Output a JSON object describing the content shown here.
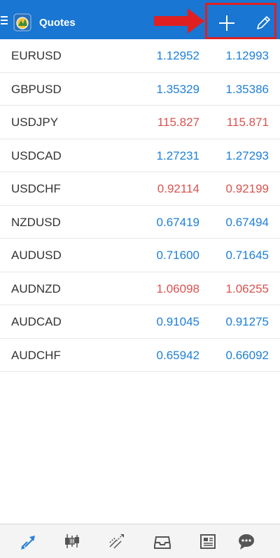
{
  "app": {
    "title": "Quotes"
  },
  "colors": {
    "accent": "#1976d2",
    "up": "#1e7fd8",
    "down": "#d9534f",
    "annotation": "#e02020",
    "nav_active": "#2a80d8",
    "nav_inactive": "#555555"
  },
  "icons": {
    "menu": "menu-icon",
    "logo": "metatrader-logo-icon",
    "add": "plus-icon",
    "edit": "pencil-icon",
    "annotation": "red-arrow-annotation"
  },
  "quotes": [
    {
      "symbol": "EURUSD",
      "bid": "1.12952",
      "ask": "1.12993",
      "direction": "up"
    },
    {
      "symbol": "GBPUSD",
      "bid": "1.35329",
      "ask": "1.35386",
      "direction": "up"
    },
    {
      "symbol": "USDJPY",
      "bid": "115.827",
      "ask": "115.871",
      "direction": "down"
    },
    {
      "symbol": "USDCAD",
      "bid": "1.27231",
      "ask": "1.27293",
      "direction": "up"
    },
    {
      "symbol": "USDCHF",
      "bid": "0.92114",
      "ask": "0.92199",
      "direction": "down"
    },
    {
      "symbol": "NZDUSD",
      "bid": "0.67419",
      "ask": "0.67494",
      "direction": "up"
    },
    {
      "symbol": "AUDUSD",
      "bid": "0.71600",
      "ask": "0.71645",
      "direction": "up"
    },
    {
      "symbol": "AUDNZD",
      "bid": "1.06098",
      "ask": "1.06255",
      "direction": "down"
    },
    {
      "symbol": "AUDCAD",
      "bid": "0.91045",
      "ask": "0.91275",
      "direction": "up"
    },
    {
      "symbol": "AUDCHF",
      "bid": "0.65942",
      "ask": "0.66092",
      "direction": "up"
    }
  ],
  "bottom_nav": [
    {
      "icon": "quotes-icon",
      "active": true
    },
    {
      "icon": "chart-icon",
      "active": false
    },
    {
      "icon": "trade-icon",
      "active": false
    },
    {
      "icon": "mailbox-icon",
      "active": false
    },
    {
      "icon": "news-icon",
      "active": false
    },
    {
      "icon": "chat-icon",
      "active": false
    }
  ]
}
